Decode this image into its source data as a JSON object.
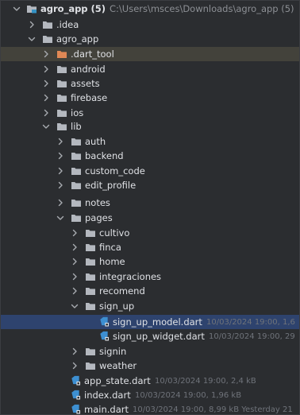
{
  "project": {
    "name": "agro_app (5)",
    "path": "C:\\Users\\msces\\Downloads\\agro_app (5)"
  },
  "tree": [
    {
      "label": "agro_app (5)",
      "depth": 0,
      "expanded": true,
      "type": "root",
      "icon": "project-folder-icon"
    },
    {
      "label": ".idea",
      "depth": 1,
      "expanded": false,
      "type": "folder",
      "icon": "folder-icon"
    },
    {
      "label": "agro_app",
      "depth": 1,
      "expanded": true,
      "type": "folder",
      "icon": "folder-icon"
    },
    {
      "label": ".dart_tool",
      "depth": 2,
      "expanded": false,
      "type": "folder",
      "icon": "folder-excluded-icon",
      "highlight": "tool"
    },
    {
      "label": "android",
      "depth": 2,
      "expanded": false,
      "type": "folder",
      "icon": "folder-icon"
    },
    {
      "label": "assets",
      "depth": 2,
      "expanded": false,
      "type": "folder",
      "icon": "folder-icon"
    },
    {
      "label": "firebase",
      "depth": 2,
      "expanded": false,
      "type": "folder",
      "icon": "folder-icon"
    },
    {
      "label": "ios",
      "depth": 2,
      "expanded": false,
      "type": "folder",
      "icon": "folder-icon"
    },
    {
      "label": "lib",
      "depth": 2,
      "expanded": true,
      "type": "folder",
      "icon": "folder-icon"
    },
    {
      "label": "auth",
      "depth": 3,
      "expanded": false,
      "type": "folder",
      "icon": "folder-icon"
    },
    {
      "label": "backend",
      "depth": 3,
      "expanded": false,
      "type": "folder",
      "icon": "folder-icon"
    },
    {
      "label": "custom_code",
      "depth": 3,
      "expanded": false,
      "type": "folder",
      "icon": "folder-icon"
    },
    {
      "label": "edit_profile",
      "depth": 3,
      "expanded": false,
      "type": "folder",
      "icon": "folder-icon"
    },
    {
      "label": "notes",
      "depth": 3,
      "expanded": false,
      "type": "folder",
      "icon": "folder-icon"
    },
    {
      "label": "pages",
      "depth": 3,
      "expanded": true,
      "type": "folder",
      "icon": "folder-icon"
    },
    {
      "label": "cultivo",
      "depth": 4,
      "expanded": false,
      "type": "folder",
      "icon": "folder-icon"
    },
    {
      "label": "finca",
      "depth": 4,
      "expanded": false,
      "type": "folder",
      "icon": "folder-icon"
    },
    {
      "label": "home",
      "depth": 4,
      "expanded": false,
      "type": "folder",
      "icon": "folder-icon"
    },
    {
      "label": "integraciones",
      "depth": 4,
      "expanded": false,
      "type": "folder",
      "icon": "folder-icon"
    },
    {
      "label": "recomend",
      "depth": 4,
      "expanded": false,
      "type": "folder",
      "icon": "folder-icon"
    },
    {
      "label": "sign_up",
      "depth": 4,
      "expanded": true,
      "type": "folder",
      "icon": "folder-icon"
    },
    {
      "label": "sign_up_model.dart",
      "depth": 5,
      "type": "file",
      "icon": "dart-file-icon",
      "meta": "10/03/2024 19:00, 1,6",
      "highlight": "selected"
    },
    {
      "label": "sign_up_widget.dart",
      "depth": 5,
      "type": "file",
      "icon": "dart-file-icon",
      "meta": "10/03/2024 19:00, 29"
    },
    {
      "label": "signin",
      "depth": 4,
      "expanded": false,
      "type": "folder",
      "icon": "folder-icon"
    },
    {
      "label": "weather",
      "depth": 4,
      "expanded": false,
      "type": "folder",
      "icon": "folder-icon"
    },
    {
      "label": "app_state.dart",
      "depth": 3,
      "type": "file",
      "icon": "dart-file-icon",
      "meta": "10/03/2024 19:00, 2,4 kB"
    },
    {
      "label": "index.dart",
      "depth": 3,
      "type": "file",
      "icon": "dart-file-icon",
      "meta": "10/03/2024 19:00, 1,96 kB"
    },
    {
      "label": "main.dart",
      "depth": 3,
      "type": "file",
      "icon": "dart-file-icon",
      "meta": "10/03/2024 19:00, 8,99 kB Yesterday 21"
    }
  ],
  "colors": {
    "background": "#2b2d30",
    "text": "#dfe1e5",
    "meta_text": "#6f737a",
    "path_text": "#8c8f94",
    "folder": "#b4b8bf",
    "excluded_folder": "#e08855",
    "dart_file": "#3d8fd1",
    "project_icon": "#3592c4",
    "selected_row": "#2e436e",
    "excluded_row": "#43423b"
  }
}
